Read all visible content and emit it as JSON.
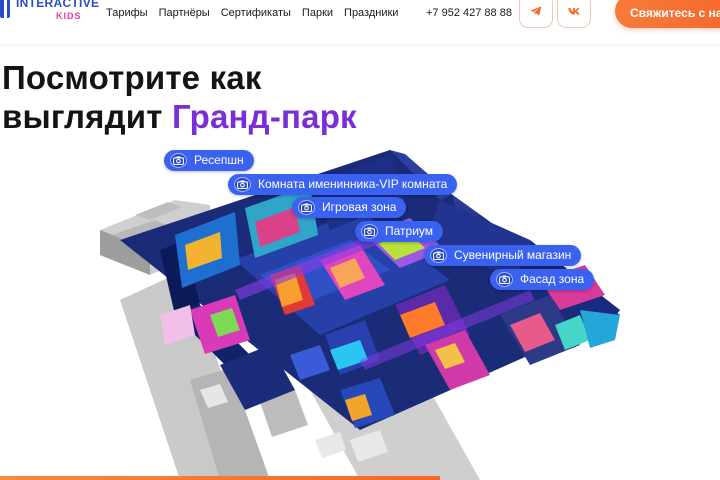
{
  "header": {
    "logo": {
      "word1": "INTERACTIVE",
      "word2": "KIDS"
    },
    "nav": [
      "Тарифы",
      "Партнёры",
      "Сертификаты",
      "Парки",
      "Праздники"
    ],
    "phone": "+7 952 427 88 88",
    "social": [
      "telegram-icon",
      "vk-icon"
    ],
    "cta_label": "Свяжитесь с нами",
    "colors": {
      "brand": "#2a4cc7",
      "accent": "#f4672a",
      "kids": "#ec3aa6"
    }
  },
  "hero": {
    "line1": "Посмотрите как",
    "line2_plain": "выглядит ",
    "line2_accent": "Гранд-парк",
    "accent_color": "#7a2ed8"
  },
  "hotspots": [
    {
      "label": "Ресепшн"
    },
    {
      "label": "Комната именинника-VIP комната"
    },
    {
      "label": "Игровая зона"
    },
    {
      "label": "Патриум"
    },
    {
      "label": "Сувенирный магазин"
    },
    {
      "label": "Фасад зона"
    }
  ],
  "hotspot_color": "#3a62f0"
}
